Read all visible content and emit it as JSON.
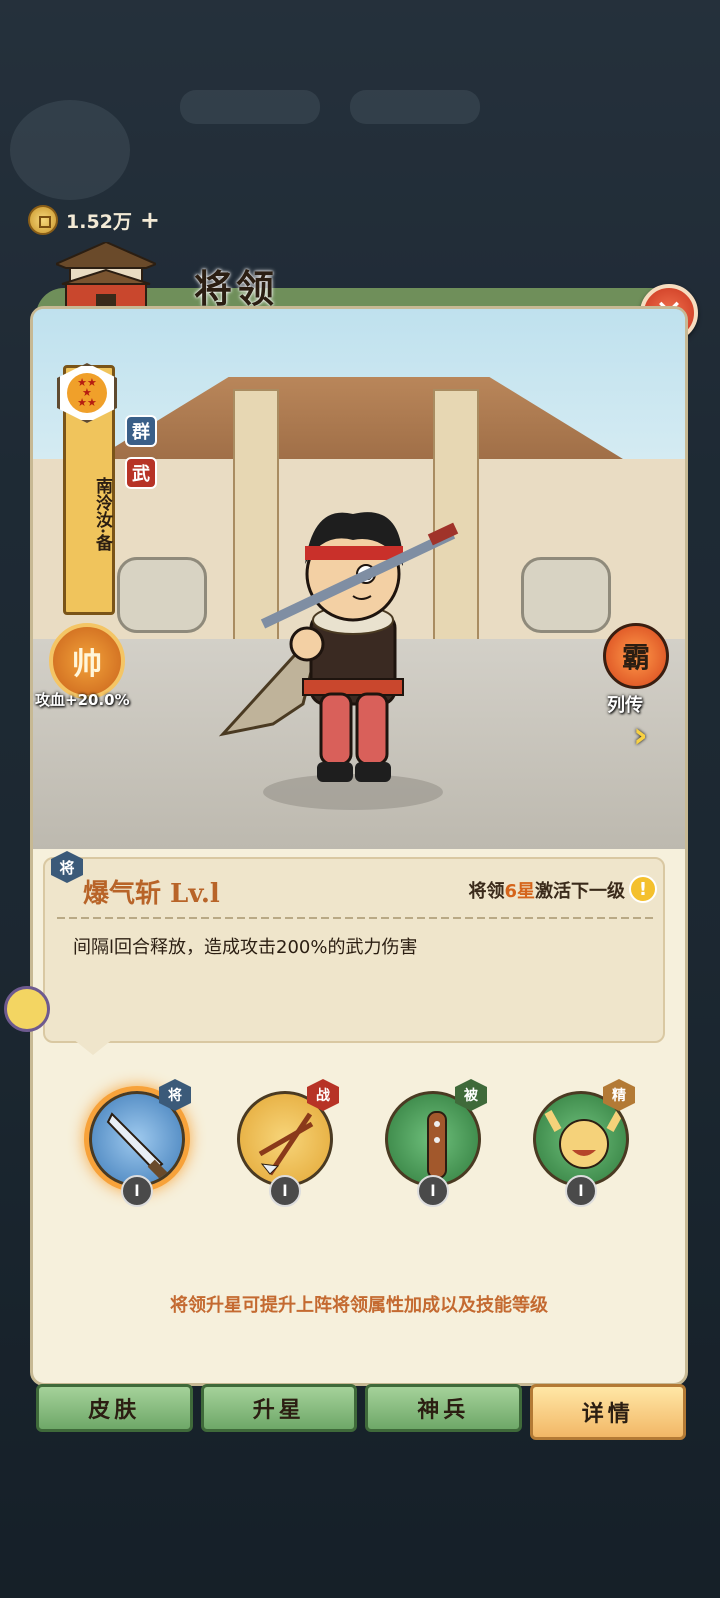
{
  "currency": {
    "amount": "1.52万",
    "plus": "+"
  },
  "header": {
    "title": "将领",
    "close_label": "✕"
  },
  "hero": {
    "name": "南泠汝·备",
    "factions": [
      "群",
      "武"
    ],
    "stars_icon": "five-star-icon",
    "rank_badge": "帅",
    "rank_bonus": "攻血+20.0%",
    "biography_badge": "霸",
    "biography_label": "列传",
    "next_icon": "chevron-right-icon"
  },
  "skill": {
    "tag": "将",
    "title": "爆气斩 Lv.l",
    "note_prefix": "将领",
    "note_highlight": "6星",
    "note_suffix": "激活下一级",
    "warn_icon": "!",
    "description": "间隔l回合释放，造成攻击200%的武力伤害"
  },
  "skills": [
    {
      "type": "将",
      "level": "l",
      "icon": "sword-icon",
      "type_color": "#3b5a79",
      "bg": "#3e7bb8"
    },
    {
      "type": "战",
      "level": "l",
      "icon": "arrows-icon",
      "type_color": "#b73326",
      "bg": "#e3a634"
    },
    {
      "type": "被",
      "level": "l",
      "icon": "club-icon",
      "type_color": "#3f6a3a",
      "bg": "#3e8a4a"
    },
    {
      "type": "精",
      "level": "l",
      "icon": "cheer-icon",
      "type_color": "#b37a35",
      "bg": "#3e8a4a"
    }
  ],
  "upgrade_hint": "将领升星可提升上阵将领属性加成以及技能等级",
  "tabs": [
    {
      "label": "皮肤",
      "active": false
    },
    {
      "label": "升星",
      "active": false
    },
    {
      "label": "神兵",
      "active": false
    },
    {
      "label": "详情",
      "active": true
    }
  ],
  "colors": {
    "accent": "#d5651b",
    "panel": "#f6f0dc",
    "tab_active": "#f2b766",
    "tab_inactive": "#6ea868"
  }
}
